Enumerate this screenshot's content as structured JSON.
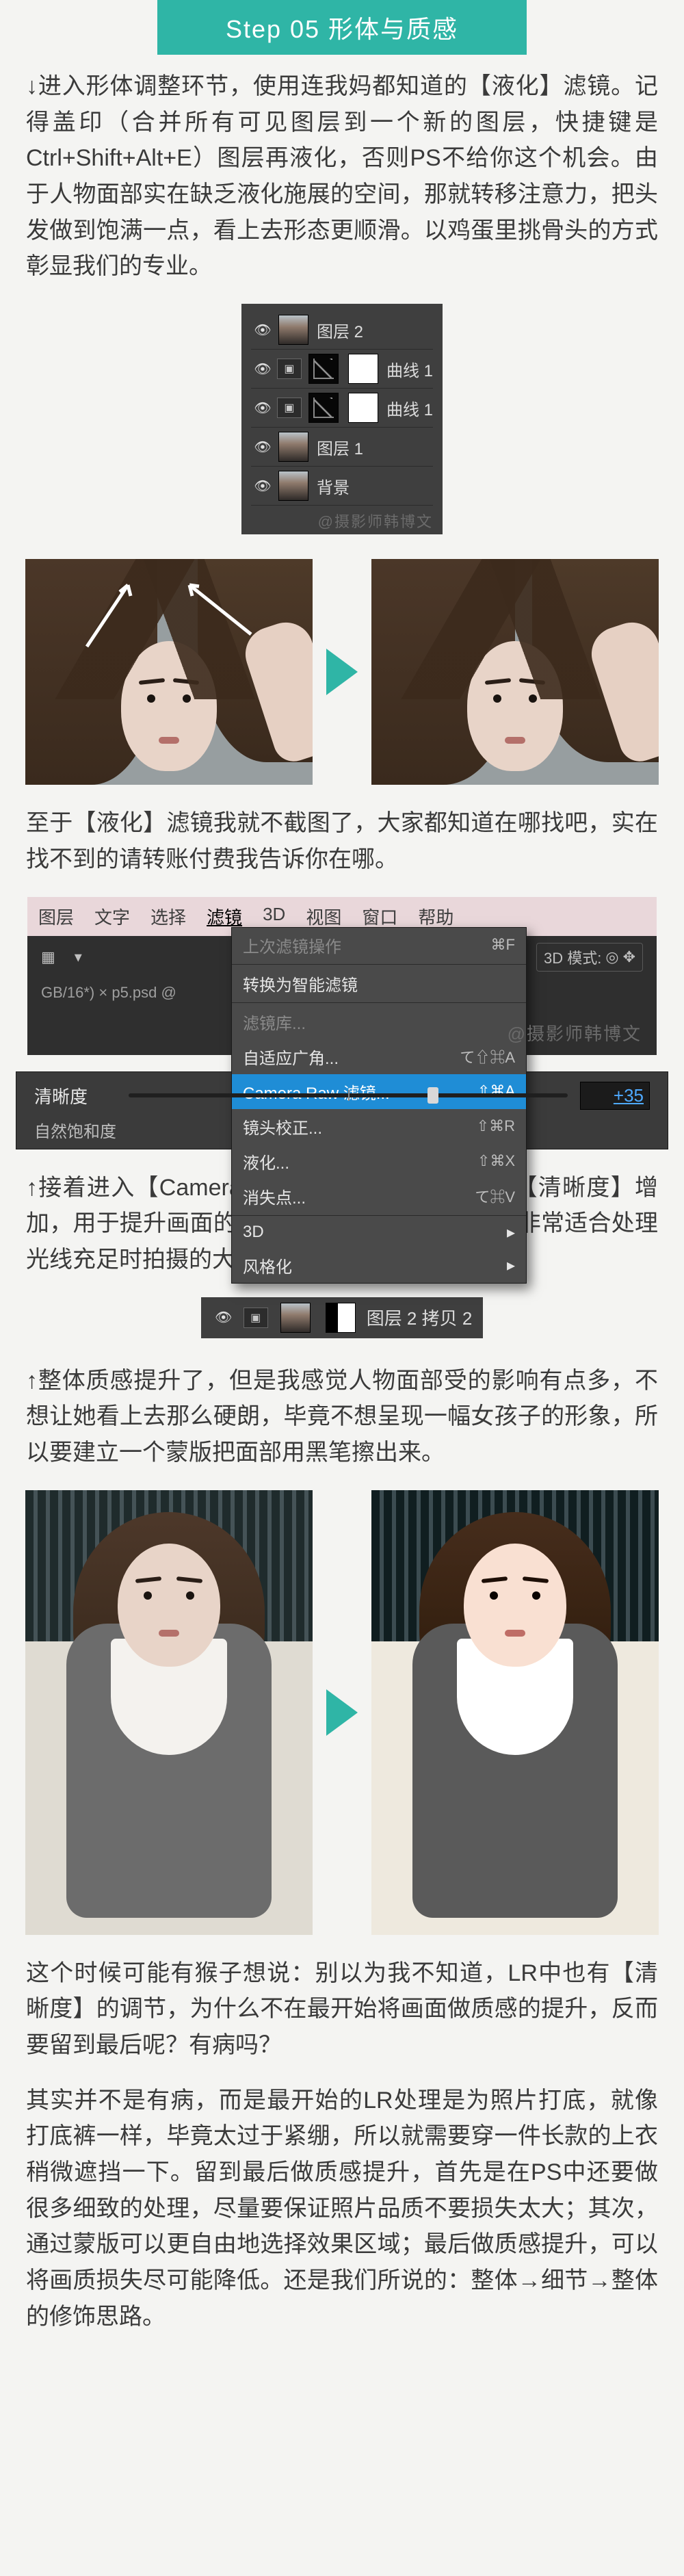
{
  "header": {
    "title": "Step 05 形体与质感"
  },
  "para1": "↓进入形体调整环节，使用连我妈都知道的【液化】滤镜。记得盖印（合并所有可见图层到一个新的图层，快捷键是Ctrl+Shift+Alt+E）图层再液化，否则PS不给你这个机会。由于人物面部实在缺乏液化施展的空间，那就转移注意力，把头发做到饱满一点，看上去形态更顺滑。以鸡蛋里挑骨头的方式彰显我们的专业。",
  "layers": {
    "rows": [
      {
        "name": "图层 2",
        "type": "portrait"
      },
      {
        "name": "曲线 1",
        "type": "curve"
      },
      {
        "name": "曲线 1",
        "type": "curve"
      },
      {
        "name": "图层 1",
        "type": "portrait"
      },
      {
        "name": "背景",
        "type": "portrait"
      }
    ],
    "watermark": "@摄影师韩博文"
  },
  "para2": "至于【液化】滤镜我就不截图了，大家都知道在哪找吧，实在找不到的请转账付费我告诉你在哪。",
  "menubar": {
    "items": [
      "图层",
      "文字",
      "选择",
      "滤镜",
      "3D",
      "视图",
      "窗口",
      "帮助"
    ],
    "active_index": 3
  },
  "secbar": {
    "label_3d": "3D 模式:"
  },
  "tabline": "GB/16*) ×   p5.psd  @",
  "dropdown": {
    "rows": [
      {
        "label": "上次滤镜操作",
        "kbd": "⌘F",
        "type": "disabled"
      },
      {
        "type": "sep"
      },
      {
        "label": "转换为智能滤镜",
        "type": "item"
      },
      {
        "type": "sep"
      },
      {
        "label": "滤镜库...",
        "type": "disabled"
      },
      {
        "label": "自适应广角...",
        "kbd": "て⇧⌘A",
        "type": "item"
      },
      {
        "label": "Camera Raw 滤镜...",
        "kbd": "⇧⌘A",
        "type": "hl"
      },
      {
        "label": "镜头校正...",
        "kbd": "⇧⌘R",
        "type": "item"
      },
      {
        "label": "液化...",
        "kbd": "⇧⌘X",
        "type": "item"
      },
      {
        "label": "消失点...",
        "kbd": "て⌘V",
        "type": "item"
      },
      {
        "type": "sep"
      },
      {
        "label": "3D",
        "type": "sub"
      },
      {
        "label": "风格化",
        "type": "sub"
      }
    ],
    "watermark": "@摄影师韩博文"
  },
  "clarity": {
    "label": "清晰度",
    "value": "+35",
    "row2": "自然饱和度"
  },
  "para3": "↑接着进入【Camera Raw滤镜】中，将画面的【清晰度】增加，用于提升画面的质感，这个效果显而易见，非常适合处理光线充足时拍摄的大片。",
  "layer_strip": {
    "name": "图层 2 拷贝 2"
  },
  "para4": "↑整体质感提升了，但是我感觉人物面部受的影响有点多，不想让她看上去那么硬朗，毕竟不想呈现一幅女孩子的形象，所以要建立一个蒙版把面部用黑笔擦出来。",
  "para5": "这个时候可能有猴子想说：别以为我不知道，LR中也有【清晰度】的调节，为什么不在最开始将画面做质感的提升，反而要留到最后呢？有病吗？",
  "para6": "其实并不是有病，而是最开始的LR处理是为照片打底，就像打底裤一样，毕竟太过于紧绷，所以就需要穿一件长款的上衣稍微遮挡一下。留到最后做质感提升，首先是在PS中还要做很多细致的处理，尽量要保证照片品质不要损失太大；其次，通过蒙版可以更自由地选择效果区域；最后做质感提升，可以将画质损失尽可能降低。还是我们所说的：整体→细节→整体的修饰思路。"
}
